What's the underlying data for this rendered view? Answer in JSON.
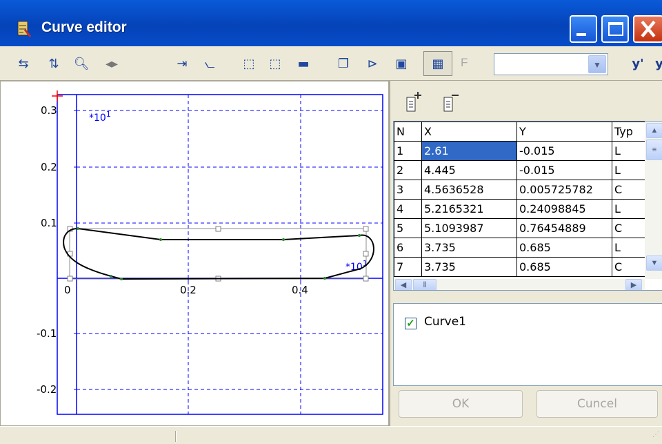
{
  "window": {
    "title": "Curve editor"
  },
  "toolbar": {
    "f_label": "F",
    "combo_value": "",
    "icons": [
      "swap-horizontal-icon",
      "swap-vertical-icon",
      "zoom-icon",
      "move-horizontal-icon",
      "goto-end-icon",
      "chart-icon",
      "select-rect-icon",
      "select-area-icon",
      "line-icon",
      "copy-icon",
      "open-icon",
      "save-icon",
      "grid-icon",
      "y-prime-icon"
    ]
  },
  "plot": {
    "y_ticks": [
      "0.3",
      "0.2",
      "0.1",
      "0",
      "-0.1",
      "-0.2"
    ],
    "x_ticks": [
      "0",
      "0.2",
      "0.4"
    ],
    "y_multiplier": "*10^1",
    "x_multiplier": "*10^1"
  },
  "table": {
    "headers": [
      "N",
      "X",
      "Y",
      "Typ"
    ],
    "rows": [
      [
        "1",
        "2.61",
        "-0.015",
        "L"
      ],
      [
        "2",
        "4.445",
        "-0.015",
        "L"
      ],
      [
        "3",
        "4.5636528",
        "0.005725782",
        "C"
      ],
      [
        "4",
        "5.2165321",
        "0.24098845",
        "L"
      ],
      [
        "5",
        "5.1093987",
        "0.76454889",
        "C"
      ],
      [
        "6",
        "3.735",
        "0.685",
        "L"
      ],
      [
        "7",
        "3.735",
        "0.685",
        "C"
      ]
    ]
  },
  "curves": [
    {
      "name": "Curve1",
      "checked": true
    }
  ],
  "buttons": {
    "ok": "OK",
    "cancel": "Cuncel"
  },
  "colors": {
    "title_bar": "#0542b8",
    "selection": "#3169c6",
    "grid": "#0000ff",
    "close": "#c4320f"
  }
}
